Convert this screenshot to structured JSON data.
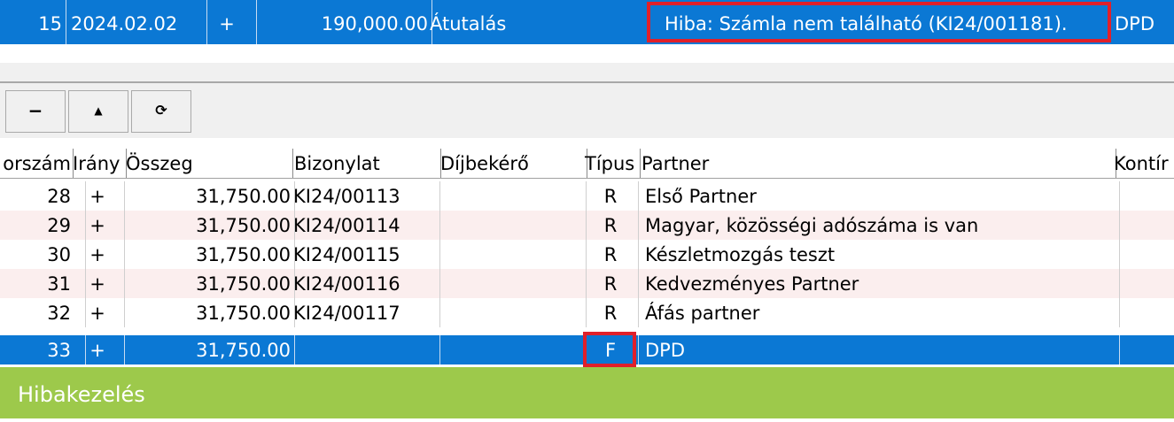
{
  "top_row": {
    "number": "15",
    "date": "2024.02.02",
    "direction": "+",
    "amount": "190,000.00",
    "payment_type": "Átutalás",
    "message": "Hiba: Számla nem található (KI24/001181).",
    "partner": "DPD"
  },
  "toolbar": {
    "delete_label": "−",
    "up_label": "▲",
    "refresh_label": "⟳"
  },
  "grid": {
    "columns": [
      "orszám",
      "Irány",
      "Összeg",
      "Bizonylat",
      "Díjbekérő",
      "Típus",
      "Partner",
      "Kontír"
    ],
    "rows": [
      {
        "no": "28",
        "dir": "+",
        "amount": "31,750.00",
        "doc": "KI24/00113",
        "fee": "",
        "type": "R",
        "partner": "Első Partner"
      },
      {
        "no": "29",
        "dir": "+",
        "amount": "31,750.00",
        "doc": "KI24/00114",
        "fee": "",
        "type": "R",
        "partner": "Magyar, közösségi adószáma is van"
      },
      {
        "no": "30",
        "dir": "+",
        "amount": "31,750.00",
        "doc": "KI24/00115",
        "fee": "",
        "type": "R",
        "partner": "Készletmozgás teszt"
      },
      {
        "no": "31",
        "dir": "+",
        "amount": "31,750.00",
        "doc": "KI24/00116",
        "fee": "",
        "type": "R",
        "partner": "Kedvezményes Partner"
      },
      {
        "no": "32",
        "dir": "+",
        "amount": "31,750.00",
        "doc": "KI24/00117",
        "fee": "",
        "type": "R",
        "partner": "Áfás partner"
      },
      {
        "no": "33",
        "dir": "+",
        "amount": "31,750.00",
        "doc": "",
        "fee": "",
        "type": "F",
        "partner": "DPD"
      }
    ]
  },
  "banner": {
    "title": "Hibakezelés"
  },
  "colors": {
    "selection": "#0b78d4",
    "highlight": "#e0202a",
    "banner": "#9dc94b",
    "alt_row": "#fbeeee"
  }
}
